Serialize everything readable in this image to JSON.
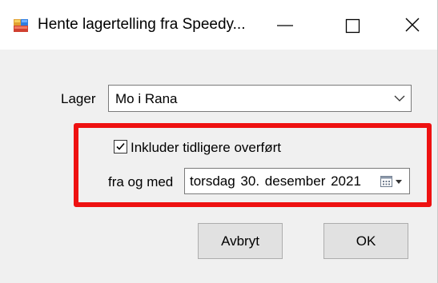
{
  "window": {
    "title": "Hente lagertelling fra Speedy...",
    "icon": "application-icon",
    "controls": [
      "minimize-icon",
      "maximize-icon",
      "close-icon"
    ]
  },
  "form": {
    "lager_label": "Lager",
    "lager_value": "Mo i Rana",
    "include_checkbox": {
      "label": "Inkluder tidligere overført",
      "checked": true
    },
    "from_label": "fra og med",
    "date_value": "torsdag 30. desember 2021"
  },
  "buttons": {
    "cancel_label": "Avbryt",
    "ok_label": "OK"
  },
  "colors": {
    "highlight_frame": "#ee1111",
    "dialog_background": "#f0f0f0",
    "button_face": "#e1e1e1"
  }
}
